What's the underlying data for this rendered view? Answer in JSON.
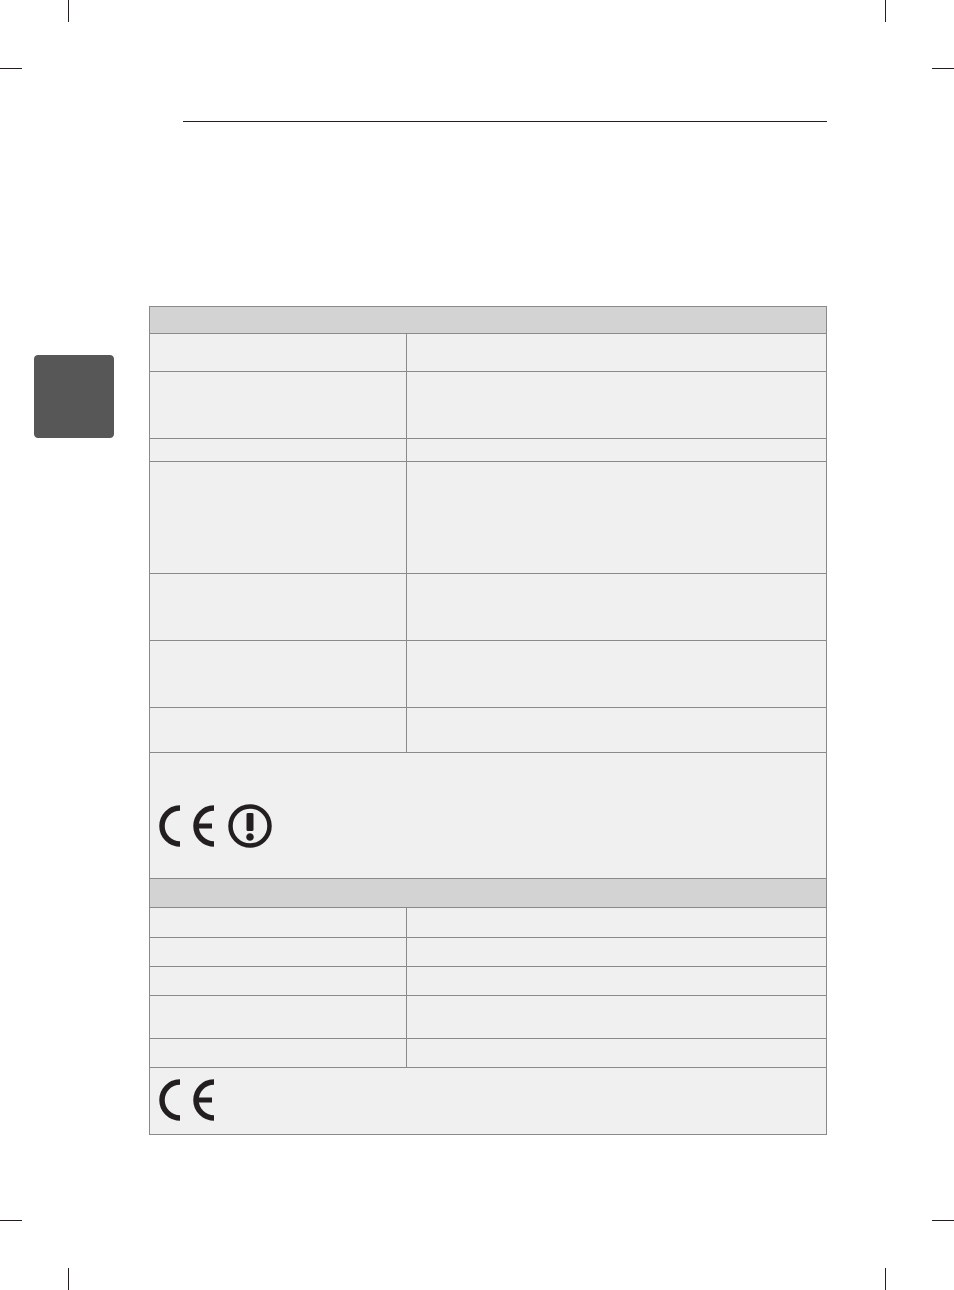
{
  "chapter_tab": {
    "color": "#575757"
  },
  "wireless_section": {
    "title": "",
    "rows": [
      {
        "label": "",
        "value": ""
      },
      {
        "label": "",
        "value": ""
      },
      {
        "label": "",
        "value": ""
      },
      {
        "label": "",
        "value": ""
      },
      {
        "label": "",
        "value": ""
      },
      {
        "label": "",
        "value": ""
      },
      {
        "label": "",
        "value": ""
      }
    ],
    "marks": [
      "ce-mark-icon",
      "alert-class-2-icon"
    ]
  },
  "second_section": {
    "title": "",
    "rows": [
      {
        "label": "",
        "value": ""
      },
      {
        "label": "",
        "value": ""
      },
      {
        "label": "",
        "value": ""
      },
      {
        "label": "",
        "value": ""
      },
      {
        "label": "",
        "value": ""
      }
    ],
    "marks": [
      "ce-mark-icon"
    ]
  },
  "colors": {
    "header_fill": "#d3d3d3",
    "row_fill": "#f0f0f0",
    "border": "#8a8a8a"
  }
}
